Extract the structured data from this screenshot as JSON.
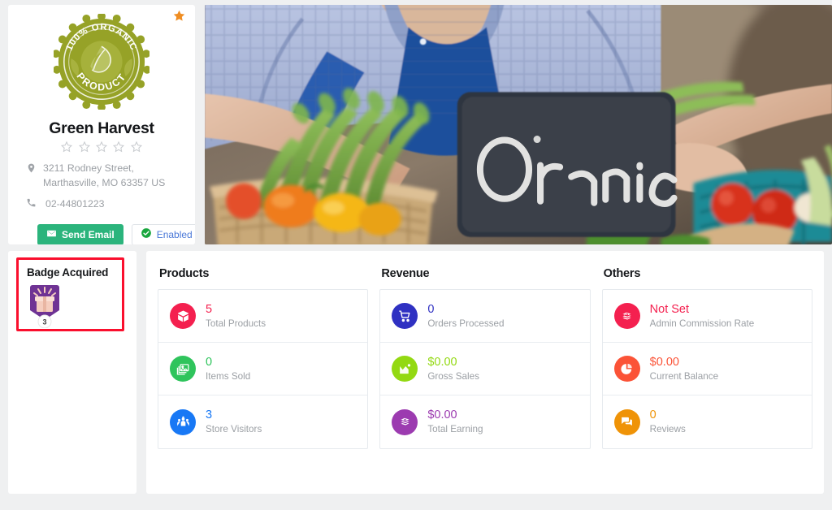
{
  "profile": {
    "favorite_icon": "star-icon",
    "logo": {
      "icon": "organic-product-stamp",
      "top_text": "100% ORGANIC",
      "bottom_text": "PRODUCT",
      "color": "#94a024"
    },
    "store_name": "Green Harvest",
    "rating": {
      "stars_total": 5,
      "stars_filled": 0
    },
    "address_icon": "map-pin-icon",
    "address": "3211 Rodney Street, Marthasville, MO 63357 US",
    "phone_icon": "phone-icon",
    "phone": "02-44801223",
    "buttons": {
      "send_email": {
        "label": "Send Email",
        "icon": "envelope-icon",
        "color": "#2bb47c"
      },
      "enabled": {
        "label": "Enabled",
        "icon": "check-circle-icon",
        "color": "#4a78d8"
      }
    }
  },
  "banner": {
    "image_description": "farmer holding a chalkboard sign at a vegetable market stall",
    "chalkboard_text": "Organic"
  },
  "badge_panel": {
    "title": "Badge Acquired",
    "badge_icon": "gift-box-shield-badge-icon",
    "badge_count": "3",
    "highlight_color": "#fa0f2d"
  },
  "stats": {
    "columns": [
      {
        "title": "Products",
        "rows": [
          {
            "icon": "package-box-icon",
            "icon_color": "#f4204f",
            "value": "5",
            "value_color": "#f4204f",
            "label": "Total Products"
          },
          {
            "icon": "photo-stack-icon",
            "icon_color": "#2fc45c",
            "value": "0",
            "value_color": "#2fc45c",
            "label": "Items Sold"
          },
          {
            "icon": "users-group-icon",
            "icon_color": "#1878f5",
            "value": "3",
            "value_color": "#1878f5",
            "label": "Store Visitors"
          }
        ]
      },
      {
        "title": "Revenue",
        "rows": [
          {
            "icon": "shopping-cart-icon",
            "icon_color": "#2f31c2",
            "value": "0",
            "value_color": "#2f31c2",
            "label": "Orders Processed"
          },
          {
            "icon": "chart-growth-icon",
            "icon_color": "#93d912",
            "value": "$0.00",
            "value_color": "#93d912",
            "label": "Gross Sales"
          },
          {
            "icon": "money-stack-icon",
            "icon_color": "#9c3bb0",
            "value": "$0.00",
            "value_color": "#9c3bb0",
            "label": "Total Earning"
          }
        ]
      },
      {
        "title": "Others",
        "rows": [
          {
            "icon": "money-stack-icon",
            "icon_color": "#f4204f",
            "value": "Not Set",
            "value_color": "#f4204f",
            "label": "Admin Commission Rate"
          },
          {
            "icon": "pie-chart-icon",
            "icon_color": "#fb5337",
            "value": "$0.00",
            "value_color": "#fb5337",
            "label": "Current Balance"
          },
          {
            "icon": "chat-bubbles-icon",
            "icon_color": "#ef9307",
            "value": "0",
            "value_color": "#ef9307",
            "label": "Reviews"
          }
        ]
      }
    ]
  }
}
